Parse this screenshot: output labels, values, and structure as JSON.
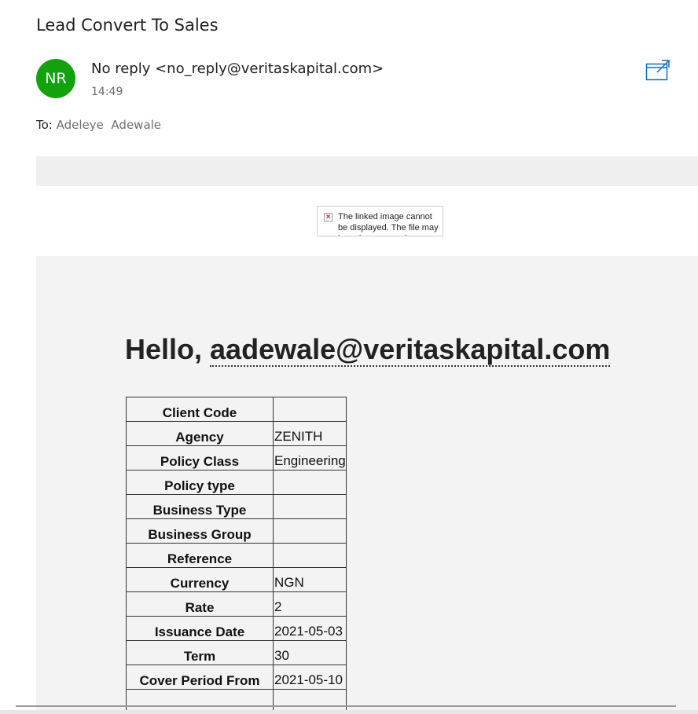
{
  "message": {
    "subject": "Lead Convert To Sales",
    "avatar_initials": "NR",
    "avatar_color": "#13a10e",
    "sender": "No reply <no_reply@veritaskapital.com>",
    "time": "14:49",
    "to_label": "To:",
    "recipient": "Adeleye  Adewale",
    "popout_icon": "open-in-new-window-icon"
  },
  "broken_image": {
    "icon": "broken-image-icon",
    "text": "The linked image cannot be displayed. The file may have been moved,"
  },
  "body": {
    "greeting": "Hello,",
    "email": "aadewale@veritaskapital.com",
    "rows": [
      {
        "label": "Client Code",
        "value": ""
      },
      {
        "label": "Agency",
        "value": "ZENITH"
      },
      {
        "label": "Policy Class",
        "value": "Engineering"
      },
      {
        "label": "Policy type",
        "value": ""
      },
      {
        "label": "Business Type",
        "value": ""
      },
      {
        "label": "Business Group",
        "value": ""
      },
      {
        "label": "Reference",
        "value": ""
      },
      {
        "label": "Currency",
        "value": "NGN"
      },
      {
        "label": "Rate",
        "value": "2"
      },
      {
        "label": "Issuance Date",
        "value": "2021-05-03"
      },
      {
        "label": "Term",
        "value": "30"
      },
      {
        "label": "Cover Period From",
        "value": "2021-05-10"
      },
      {
        "label": "",
        "value": ""
      }
    ]
  },
  "colors": {
    "accent": "#0f6cbd",
    "panel_bg": "#f3f3f3"
  }
}
